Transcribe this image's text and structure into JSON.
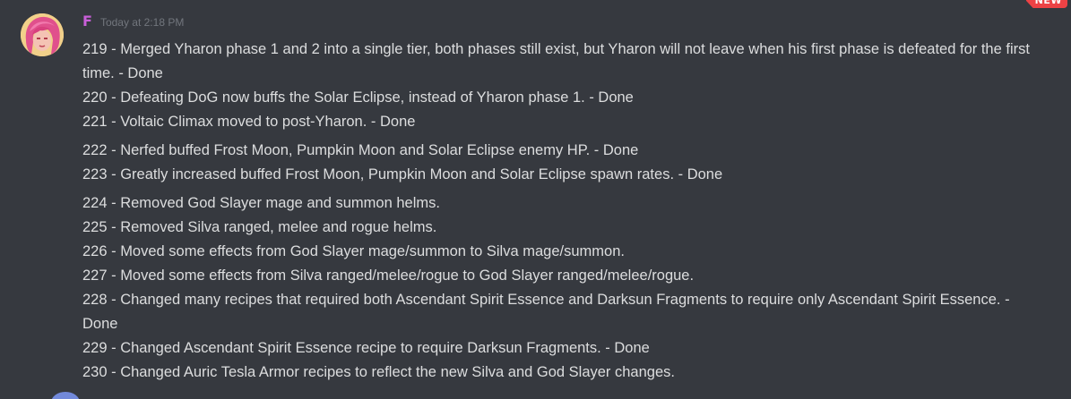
{
  "badge": {
    "label": "NEW"
  },
  "message": {
    "author": "F",
    "timestamp": "Today at 2:18 PM",
    "lines": [
      "219 - Merged Yharon phase 1 and 2 into a single tier, both phases still exist, but Yharon will not leave when his first phase is defeated for the first time. - Done",
      "220 - Defeating DoG now buffs the Solar Eclipse, instead of Yharon phase 1. - Done",
      "221 - Voltaic Climax moved to post-Yharon. - Done",
      "222 - Nerfed buffed Frost Moon, Pumpkin Moon and Solar Eclipse enemy HP. - Done",
      "223 - Greatly increased buffed Frost Moon, Pumpkin Moon and Solar Eclipse spawn rates. - Done",
      "224 - Removed God Slayer mage and summon helms.",
      "225 - Removed Silva ranged, melee and rogue helms.",
      "226 - Moved some effects from God Slayer mage/summon to Silva mage/summon.",
      "227 - Moved some effects from Silva ranged/melee/rogue to God Slayer ranged/melee/rogue.",
      "228 - Changed many recipes that required both Ascendant Spirit Essence and Darksun Fragments to require only Ascendant Spirit Essence. - Done",
      "229 - Changed Ascendant Spirit Essence recipe to require Darksun Fragments. - Done",
      "230 - Changed Auric Tesla Armor recipes to reflect the new Silva and God Slayer changes."
    ]
  },
  "colors": {
    "background": "#36393f",
    "text": "#dcddde",
    "username": "#c95fd9",
    "timestamp": "#72767d",
    "badge": "#ed4245"
  }
}
